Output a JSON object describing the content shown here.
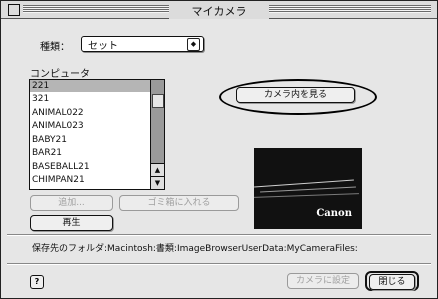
{
  "window": {
    "title": "マイカメラ"
  },
  "type": {
    "label": "種類：",
    "value": "セット"
  },
  "computer": {
    "label": "コンピュータ",
    "items": [
      "221",
      "321",
      "ANIMAL022",
      "ANIMAL023",
      "BABY21",
      "BAR21",
      "BASEBALL21",
      "CHIMPAN21"
    ],
    "selected_index": 0
  },
  "buttons": {
    "add": "追加...",
    "trash": "ゴミ箱に入れる",
    "play": "再生",
    "view_in_camera": "カメラ内を見る",
    "set_to_camera": "カメラに設定",
    "close": "閉じる"
  },
  "preview": {
    "brand": "Canon"
  },
  "save_folder": "保存先のフォルダ:Macintosh:書類:ImageBrowserUserData:MyCameraFiles:",
  "help": "?"
}
